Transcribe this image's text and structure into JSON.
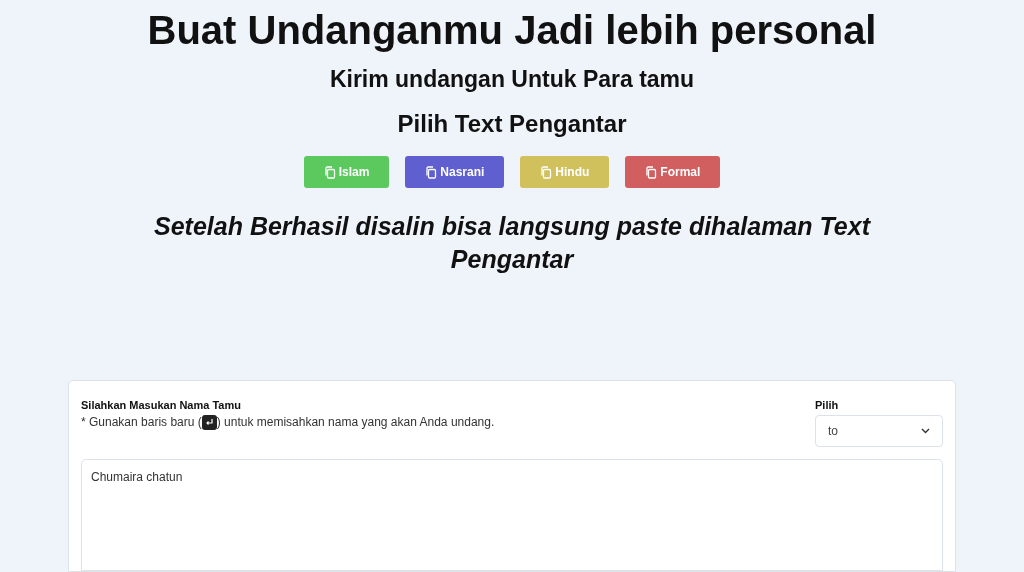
{
  "title": "Buat Undanganmu Jadi lebih personal",
  "subtitle": "Kirim undangan Untuk Para tamu",
  "section_title": "Pilih Text Pengantar",
  "copy_buttons": [
    {
      "label": "Islam",
      "color": "#5cc95f"
    },
    {
      "label": "Nasrani",
      "color": "#5f5fcf"
    },
    {
      "label": "Hindu",
      "color": "#d1c15c"
    },
    {
      "label": "Formal",
      "color": "#d15f5f"
    }
  ],
  "note": "Setelah Berhasil disalin bisa langsung paste dihalaman Text Pengantar",
  "form": {
    "name_label": "Silahkan Masukan Nama Tamu",
    "hint_before": "* Gunakan baris baru (",
    "hint_after": ") untuk memisahkan nama yang akan Anda undang.",
    "select_label": "Pilih",
    "select_value": "to",
    "names_value": "Chumaira chatun"
  }
}
